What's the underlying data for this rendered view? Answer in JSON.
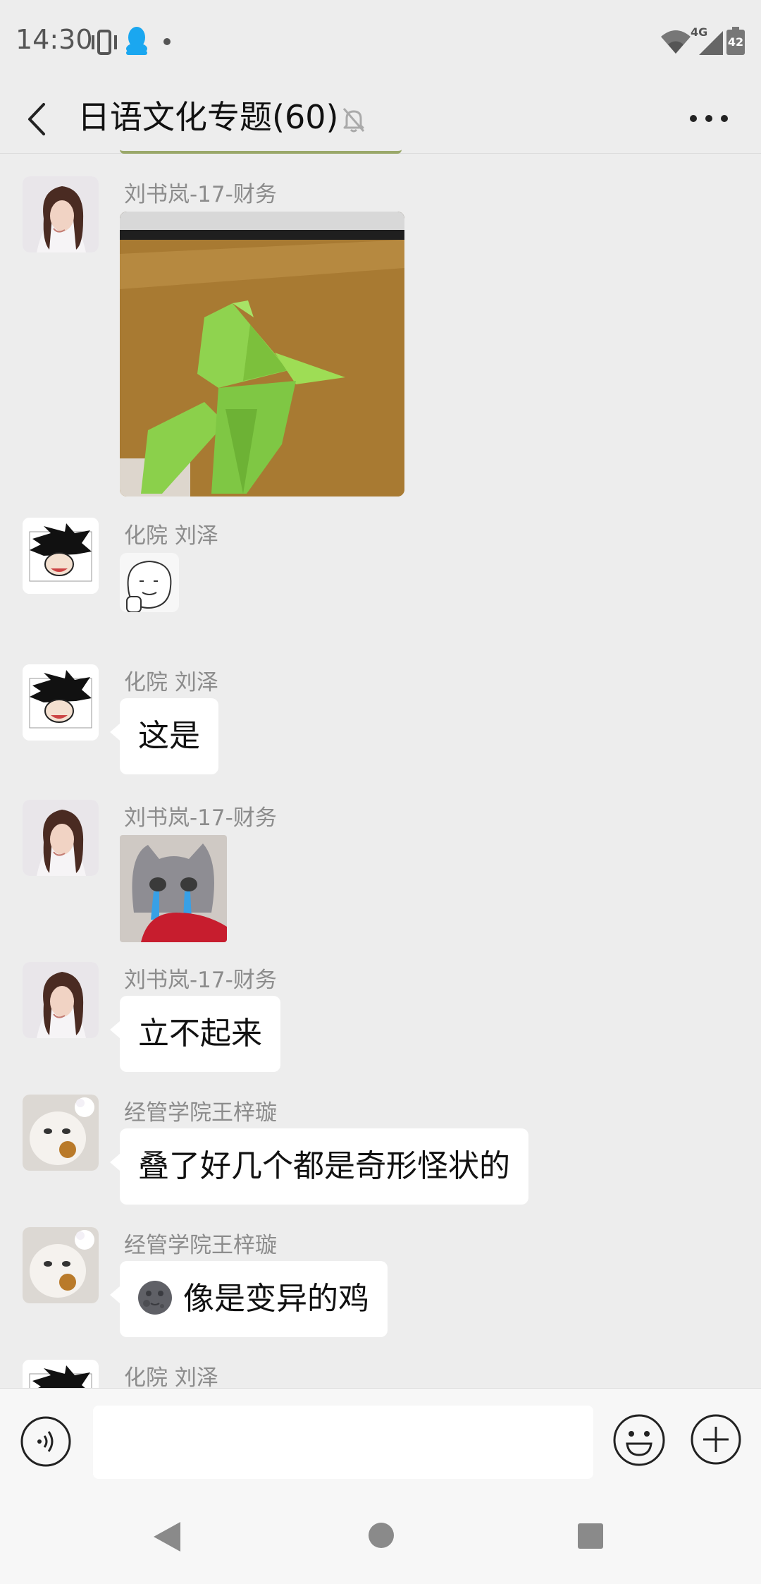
{
  "status_bar": {
    "time": "14:30",
    "network_type": "4G",
    "battery": "42",
    "icons": [
      "vibrate-icon",
      "qq-icon",
      "notification-dot-icon",
      "wifi-icon",
      "signal-icon",
      "battery-icon"
    ]
  },
  "header": {
    "title": "日语文化专题(60)",
    "icons": [
      "back-arrow-icon",
      "mute-bell-icon",
      "more-dots-icon"
    ]
  },
  "messages": [
    {
      "sender": "刘书岚-17-财务",
      "type": "image",
      "content_desc": "green paper origami crane on wooden table",
      "avatar": "avatar-girl"
    },
    {
      "sender": "化院 刘泽",
      "type": "sticker",
      "content_desc": "line-drawn face sticker",
      "avatar": "avatar-manga"
    },
    {
      "sender": "化院 刘泽",
      "type": "text",
      "text": "这是",
      "avatar": "avatar-manga"
    },
    {
      "sender": "刘书岚-17-财务",
      "type": "sticker",
      "content_desc": "crying grey cat sticker",
      "avatar": "avatar-girl"
    },
    {
      "sender": "刘书岚-17-财务",
      "type": "text",
      "text": "立不起来",
      "avatar": "avatar-girl"
    },
    {
      "sender": "经管学院王梓璇",
      "type": "text",
      "text": "叠了好几个都是奇形怪状的",
      "avatar": "avatar-cat"
    },
    {
      "sender": "经管学院王梓璇",
      "type": "text",
      "emoji": "moon-face-emoji",
      "text": "像是变异的鸡",
      "avatar": "avatar-cat"
    },
    {
      "sender": "化院 刘泽",
      "type": "partial",
      "avatar": "avatar-manga"
    }
  ],
  "input_bar": {
    "value": "",
    "icons": [
      "voice-icon",
      "emoji-icon",
      "plus-icon"
    ]
  },
  "nav_bar": {
    "icons": [
      "nav-back-icon",
      "nav-home-icon",
      "nav-recents-icon"
    ]
  },
  "colors": {
    "background": "#ededed",
    "bubble": "#ffffff",
    "sender_text": "#8c8c8c",
    "bar": "#f7f7f7"
  }
}
